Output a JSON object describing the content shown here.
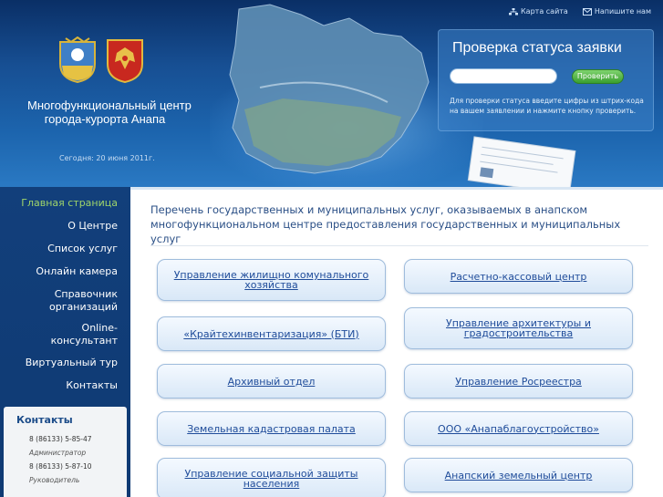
{
  "header": {
    "org_line1": "Многофункциональный центр",
    "org_line2": "города-курорта Анапа",
    "today_label": "Сегодня:",
    "today_date": "20 июня 2011г.",
    "links": {
      "sitemap": "Карта сайта",
      "write_us": "Напишите нам"
    }
  },
  "status_check": {
    "title": "Проверка статуса заявки",
    "input_value": "",
    "button_label": "Проверить",
    "hint": "Для проверки статуса введите цифры из штрих-кода на вашем заявлении и нажмите кнопку проверить."
  },
  "nav": {
    "items": [
      {
        "label": "Главная страница"
      },
      {
        "label": "О Центре"
      },
      {
        "label": "Список услуг"
      },
      {
        "label": "Онлайн камера"
      },
      {
        "label": "Справочник организаций"
      },
      {
        "label": "Online-консультант"
      },
      {
        "label": "Виртуальный тур"
      },
      {
        "label": "Контакты"
      }
    ]
  },
  "contacts": {
    "title": "Контакты",
    "phone1": "8 (86133) 5-85-47",
    "role1": "Администратор",
    "phone2": "8 (86133) 5-87-10",
    "role2": "Руководитель"
  },
  "main": {
    "title": "Перечень государственных и муниципальных услуг, оказываемых в анапском многофункциональном центре предоставления государственных и муниципальных услуг",
    "services": [
      {
        "label": "Управление жилищно комунального хозяйства"
      },
      {
        "label": "Расчетно-кассовый центр"
      },
      {
        "label": "«Крайтехинвентаризация» (БТИ)"
      },
      {
        "label": "Управление архитектуры и градостроительства"
      },
      {
        "label": "Архивный отдел"
      },
      {
        "label": "Управление Росреестра"
      },
      {
        "label": "Земельная кадастровая палата"
      },
      {
        "label": "ООО «Анапаблагоустройство»"
      },
      {
        "label": "Управление социальной защиты населения"
      },
      {
        "label": "Анапский земельный центр"
      }
    ]
  },
  "colors": {
    "header_dark": "#0a2f66",
    "sidebar": "#123f7b",
    "active_nav": "#9fd46a",
    "link_blue": "#1f4c9a",
    "button_green": "#3a9f2f"
  }
}
